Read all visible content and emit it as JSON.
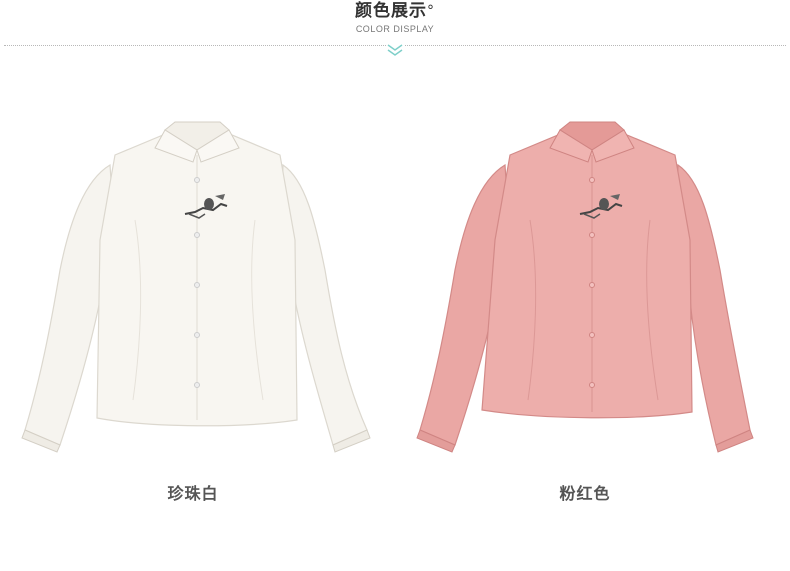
{
  "header": {
    "title": "颜色展示",
    "title_mark": "°",
    "subtitle": "COLOR DISPLAY"
  },
  "products": [
    {
      "color_name": "珍珠白",
      "fabric_color": "#f7f5f0",
      "shade_color": "#e3dfd6"
    },
    {
      "color_name": "粉红色",
      "fabric_color": "#eba9a6",
      "shade_color": "#d98d8b"
    }
  ],
  "colors": {
    "accent": "#7ecfc9",
    "text": "#333333"
  }
}
